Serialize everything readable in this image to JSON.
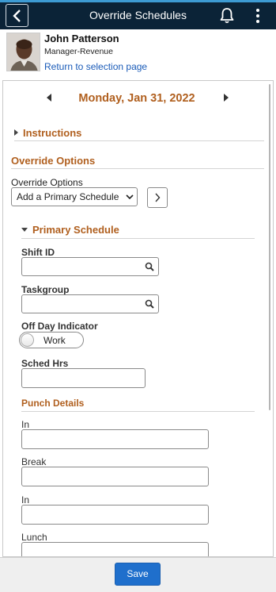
{
  "header": {
    "title": "Override Schedules",
    "back_icon": "chevron-left-icon",
    "notification_icon": "bell-icon",
    "menu_icon": "kebab-menu-icon"
  },
  "profile": {
    "name": "John Patterson",
    "title": "Manager-Revenue",
    "link": "Return to selection page"
  },
  "date_nav": {
    "date": "Monday, Jan 31, 2022"
  },
  "instructions": {
    "label": "Instructions"
  },
  "override_options": {
    "section_title": "Override Options",
    "field_label": "Override Options",
    "selected_value": "Add a Primary Schedule"
  },
  "primary_schedule": {
    "section_title": "Primary Schedule",
    "shift_id_label": "Shift ID",
    "shift_id_value": "",
    "taskgroup_label": "Taskgroup",
    "taskgroup_value": "",
    "off_day_label": "Off Day Indicator",
    "off_day_value": "Work",
    "sched_hrs_label": "Sched Hrs",
    "sched_hrs_value": ""
  },
  "punch_details": {
    "section_title": "Punch Details",
    "fields": [
      {
        "label": "In",
        "value": ""
      },
      {
        "label": "Break",
        "value": ""
      },
      {
        "label": "In",
        "value": ""
      },
      {
        "label": "Lunch",
        "value": ""
      }
    ]
  },
  "footer": {
    "save_label": "Save"
  },
  "colors": {
    "header_bg": "#0b2337",
    "accent_strip": "#3d9bd3",
    "section_title": "#b05f1e",
    "link": "#1a5bb8",
    "primary_button": "#1f6fcc"
  }
}
